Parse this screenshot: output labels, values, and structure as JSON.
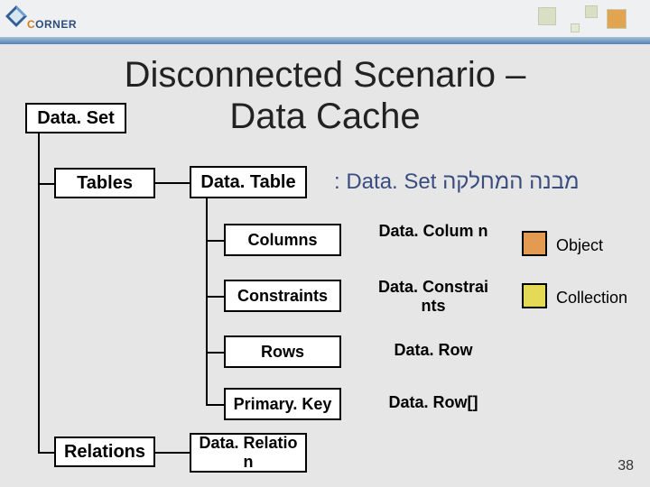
{
  "brand": {
    "first": "C",
    "rest": "ORNER"
  },
  "title": "Disconnected Scenario – Data Cache",
  "subtitle": "מבנה המחלקה Data. Set :",
  "nodes": {
    "dataset": "Data. Set",
    "tables": "Tables",
    "relations": "Relations",
    "datatable": "Data. Table",
    "datarelation": "Data. Relatio n",
    "columns": "Columns",
    "constraints": "Constraints",
    "rows": "Rows",
    "primarykey": "Primary. Key"
  },
  "types": {
    "datacolumn": "Data. Colum n",
    "dataconstraints": "Data. Constrai nts",
    "datarow": "Data. Row",
    "datarowarr": "Data. Row[]"
  },
  "legend": {
    "object": "Object",
    "collection": "Collection"
  },
  "page": "38"
}
